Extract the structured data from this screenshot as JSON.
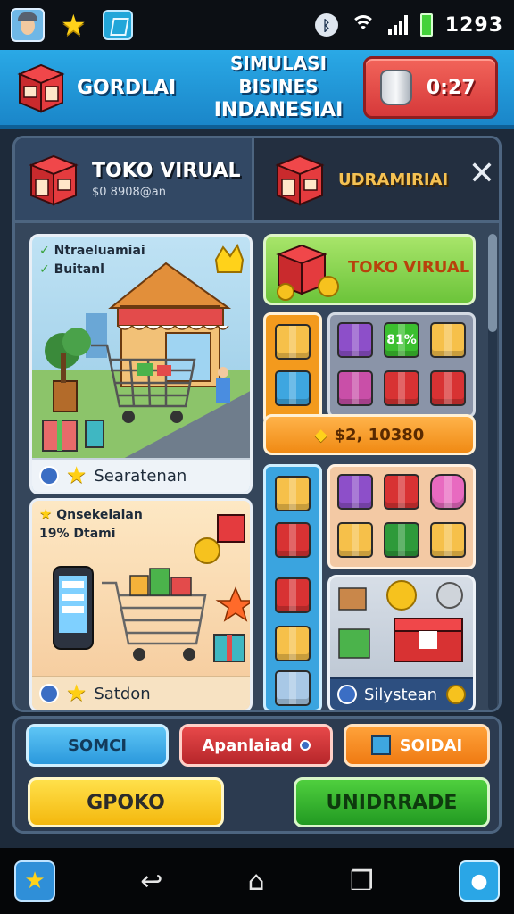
{
  "status_bar": {
    "time": "1293",
    "icons": [
      "avatar-icon",
      "star-icon",
      "app-icon",
      "bluetooth-icon",
      "wifi-icon",
      "signal-icon",
      "battery-icon"
    ]
  },
  "header": {
    "game_name": "GORDLAI",
    "title_line1": "SIMULASI BISINES",
    "title_line2": "INDANESIAI",
    "timer": "0:27"
  },
  "tabs": {
    "active": {
      "title": "TOKO VIRUAL",
      "subtitle": "$0 8908@an"
    },
    "inactive": {
      "title": "UDRAMIRIAI"
    }
  },
  "cards": {
    "store": {
      "tag1": "Ntraeluamiai",
      "tag2": "Buitanl",
      "footer": "Searatenan"
    },
    "shopping": {
      "tag1": "Qnsekelaian",
      "tag2": "19% Dtami",
      "footer": "Satdon"
    },
    "toko": {
      "label": "TOKO VIRUAL"
    },
    "percent_label": "81%",
    "price_bar": "$2, 10380",
    "system": {
      "footer": "Silystean"
    }
  },
  "actions": {
    "btn1": "SOMCI",
    "btn2": "Apanlaiad",
    "btn3": "SOIDAI",
    "btn4": "GPOKO",
    "btn5": "UNIDRRADE"
  },
  "colors": {
    "header_blue": "#1a86c9",
    "timer_red": "#d6393a",
    "green": "#3bbf2f",
    "orange": "#f39a1d",
    "yellow": "#f6c21e",
    "box_red": "#d83233"
  }
}
